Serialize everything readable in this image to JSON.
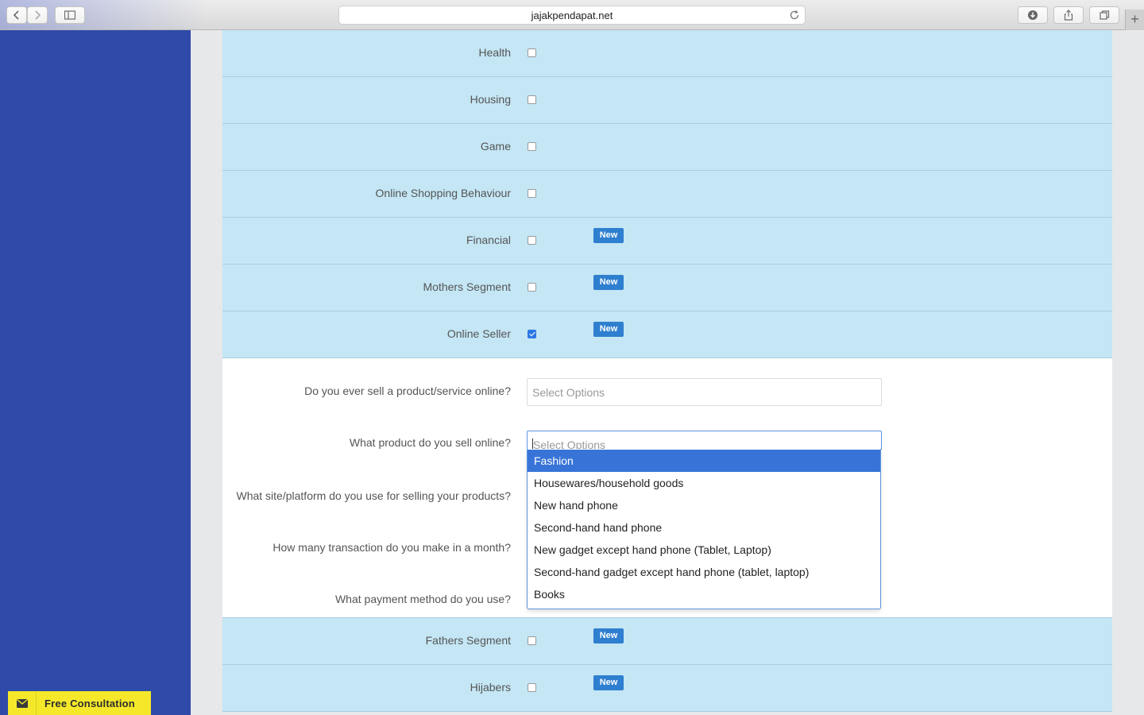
{
  "browser": {
    "url": "jajakpendapat.net"
  },
  "sidebar": {
    "consult_label": "Free Consultation"
  },
  "segments_top": [
    {
      "label": "Health",
      "checked": false,
      "badge": ""
    },
    {
      "label": "Housing",
      "checked": false,
      "badge": ""
    },
    {
      "label": "Game",
      "checked": false,
      "badge": ""
    },
    {
      "label": "Online Shopping Behaviour",
      "checked": false,
      "badge": ""
    },
    {
      "label": "Financial",
      "checked": false,
      "badge": "New"
    },
    {
      "label": "Mothers Segment",
      "checked": false,
      "badge": "New"
    },
    {
      "label": "Online Seller",
      "checked": true,
      "badge": "New"
    }
  ],
  "online_seller_questions": {
    "q1": {
      "label": "Do you ever sell a product/service online?",
      "placeholder": "Select Options"
    },
    "q2": {
      "label": "What product do you sell online?",
      "placeholder": "Select Options"
    },
    "q3": {
      "label": "What site/platform do you use for selling your products?"
    },
    "q4": {
      "label": "How many transaction do you make in a month?"
    },
    "q5": {
      "label": "What payment method do you use?"
    }
  },
  "dropdown": {
    "highlighted_index": 0,
    "options": [
      "Fashion",
      "Housewares/household goods",
      "New hand phone",
      "Second-hand hand phone",
      "New gadget except hand phone (Tablet, Laptop)",
      "Second-hand gadget except hand phone (tablet, laptop)",
      "Books"
    ]
  },
  "segments_bottom": [
    {
      "label": "Fathers Segment",
      "checked": false,
      "badge": "New"
    },
    {
      "label": "Hijabers",
      "checked": false,
      "badge": "New"
    }
  ],
  "colors": {
    "sidebar": "#2f4aa8",
    "row_bg": "#c4e6f5",
    "badge": "#2e7fcf",
    "highlight": "#3874d8",
    "consult_bg": "#f5e82a"
  }
}
